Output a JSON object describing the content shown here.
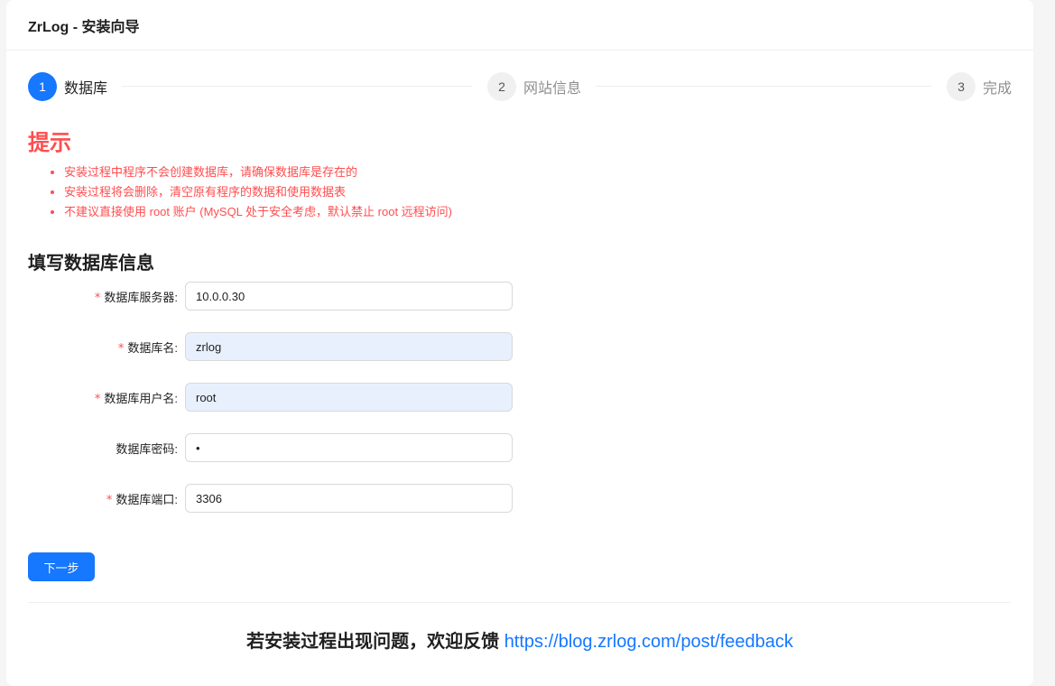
{
  "header": {
    "title": "ZrLog - 安装向导"
  },
  "steps": [
    {
      "number": "1",
      "title": "数据库",
      "status": "active"
    },
    {
      "number": "2",
      "title": "网站信息",
      "status": "wait"
    },
    {
      "number": "3",
      "title": "完成",
      "status": "wait"
    }
  ],
  "tips": {
    "title": "提示",
    "items": [
      "安装过程中程序不会创建数据库，请确保数据库是存在的",
      "安装过程将会删除，清空原有程序的数据和使用数据表",
      "不建议直接使用 root 账户 (MySQL 处于安全考虑，默认禁止 root 远程访问)"
    ]
  },
  "form": {
    "title": "填写数据库信息",
    "fields": [
      {
        "label": "数据库服务器:",
        "required": true,
        "value": "10.0.0.30"
      },
      {
        "label": "数据库名:",
        "required": true,
        "value": "zrlog"
      },
      {
        "label": "数据库用户名:",
        "required": true,
        "value": "root"
      },
      {
        "label": "数据库密码:",
        "required": false,
        "value": "•"
      },
      {
        "label": "数据库端口:",
        "required": true,
        "value": "3306"
      }
    ],
    "next_label": "下一步"
  },
  "footer": {
    "text": "若安装过程出现问题，欢迎反馈",
    "link": "https://blog.zrlog.com/post/feedback"
  },
  "colors": {
    "primary": "#1677ff",
    "danger": "#ff4d4f",
    "autofill_bg": "#e8f0fe"
  }
}
